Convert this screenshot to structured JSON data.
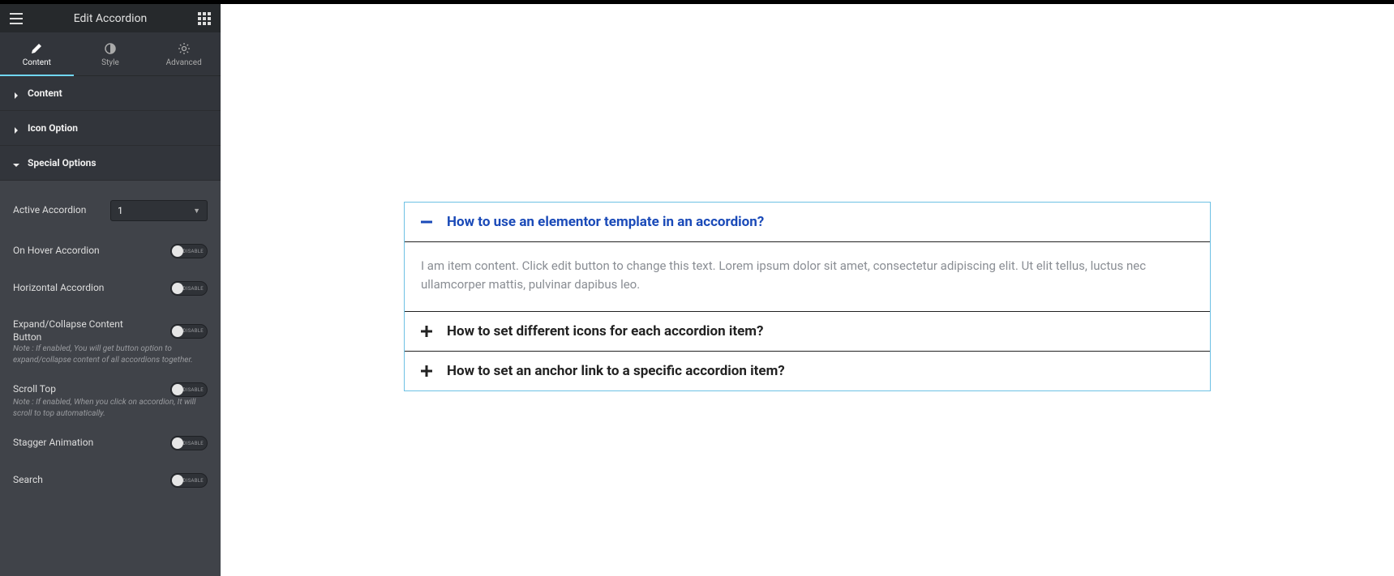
{
  "header": {
    "title": "Edit Accordion"
  },
  "tabs": {
    "content": "Content",
    "style": "Style",
    "advanced": "Advanced"
  },
  "sections": {
    "content": "Content",
    "icon_option": "Icon Option",
    "special_options": "Special Options"
  },
  "controls": {
    "active_accordion": {
      "label": "Active Accordion",
      "value": "1"
    },
    "on_hover": {
      "label": "On Hover Accordion",
      "state": "DISABLE"
    },
    "horizontal": {
      "label": "Horizontal Accordion",
      "state": "DISABLE"
    },
    "expand_collapse": {
      "label": "Expand/Collapse Content Button",
      "state": "DISABLE",
      "note": "Note : If enabled, You will get button option to expand/collapse content of all accordions together."
    },
    "scroll_top": {
      "label": "Scroll Top",
      "state": "DISABLE",
      "note": "Note : If enabled, When you click on accordion, It will scroll to top automatically."
    },
    "stagger": {
      "label": "Stagger Animation",
      "state": "DISABLE"
    },
    "search": {
      "label": "Search",
      "state": "DISABLE"
    }
  },
  "accordion": {
    "items": [
      {
        "title": "How to use an elementor template in an accordion?",
        "open": true,
        "content": "I am item content. Click edit button to change this text. Lorem ipsum dolor sit amet, consectetur adipiscing elit. Ut elit tellus, luctus nec ullamcorper mattis, pulvinar dapibus leo."
      },
      {
        "title": "How to set different icons for each accordion item?",
        "open": false
      },
      {
        "title": "How to set an anchor link to a specific accordion item?",
        "open": false
      }
    ]
  }
}
